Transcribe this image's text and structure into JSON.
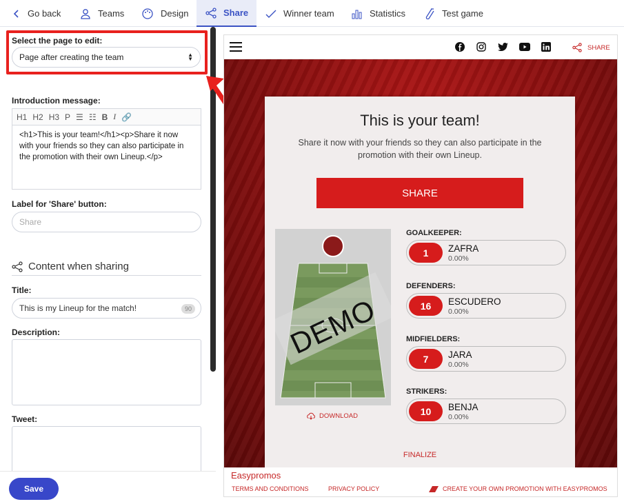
{
  "nav": {
    "tabs": [
      {
        "label": "Go back",
        "icon": "chevron-left-icon"
      },
      {
        "label": "Teams",
        "icon": "user-icon"
      },
      {
        "label": "Design",
        "icon": "palette-icon"
      },
      {
        "label": "Share",
        "icon": "share-icon",
        "active": true
      },
      {
        "label": "Winner team",
        "icon": "check-icon"
      },
      {
        "label": "Statistics",
        "icon": "bar-chart-icon"
      },
      {
        "label": "Test game",
        "icon": "flask-icon"
      }
    ]
  },
  "editor": {
    "page_select_label": "Select the page to edit:",
    "page_select_value": "Page after creating the team",
    "intro_label": "Introduction message:",
    "toolbar": [
      "H1",
      "H2",
      "H3",
      "P"
    ],
    "intro_html": "<h1>This is your team!</h1><p>Share it now with your friends so they can also participate in the promotion with their own Lineup.</p>",
    "share_label_label": "Label for 'Share' button:",
    "share_label_placeholder": "Share",
    "section_title": "Content when sharing",
    "title_label": "Title:",
    "title_value": "This is my Lineup for the match!",
    "title_counter": "90",
    "description_label": "Description:",
    "tweet_label": "Tweet:",
    "save_label": "Save"
  },
  "preview": {
    "share_label": "SHARE",
    "heading": "This is your team!",
    "message": "Share it now with your friends so they can also participate in the promotion with their own Lineup.",
    "share_button": "SHARE",
    "demo_text": "DEMO",
    "download_label": "DOWNLOAD",
    "positions": [
      {
        "label": "GOALKEEPER:",
        "number": "1",
        "name": "ZAFRA",
        "pct": "0.00%"
      },
      {
        "label": "DEFENDERS:",
        "number": "16",
        "name": "ESCUDERO",
        "pct": "0.00%"
      },
      {
        "label": "MIDFIELDERS:",
        "number": "7",
        "name": "JARA",
        "pct": "0.00%"
      },
      {
        "label": "STRIKERS:",
        "number": "10",
        "name": "BENJA",
        "pct": "0.00%"
      }
    ],
    "finalize_label": "FINALIZE",
    "footer_brand": "Easypromos",
    "footer_terms": "TERMS AND CONDITIONS",
    "footer_privacy": "PRIVACY POLICY",
    "footer_create": "CREATE YOUR OWN PROMOTION WITH EASYPROMOS"
  },
  "colors": {
    "accent": "#3a52c4",
    "brand_red": "#d61c1c",
    "highlight": "#e8211e"
  }
}
